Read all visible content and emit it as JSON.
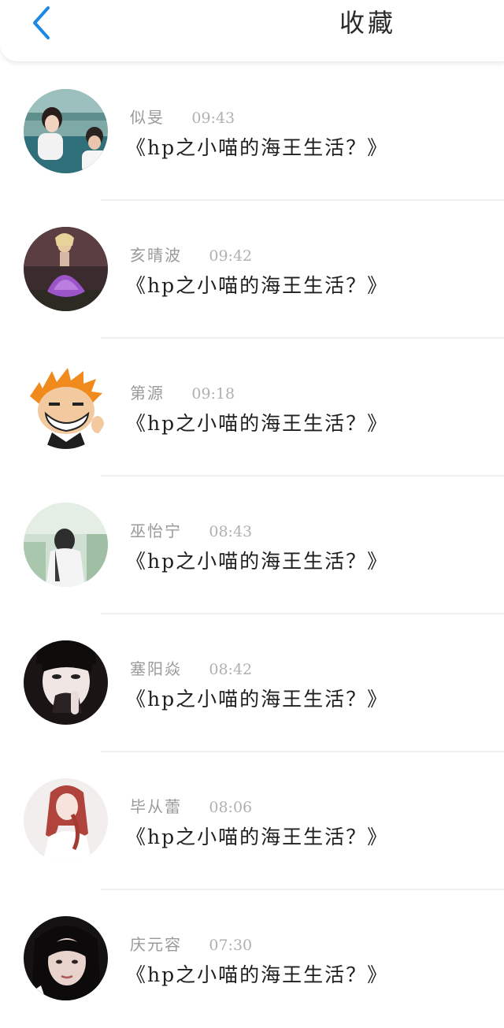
{
  "header": {
    "back_icon": "chevron-left-icon",
    "title": "收藏",
    "accent_color": "#1e88e5"
  },
  "items": [
    {
      "name": "似旻",
      "time": "09:43",
      "message": "《hp之小喵的海王生活？》",
      "avatar": "couple-train-photo"
    },
    {
      "name": "亥晴波",
      "time": "09:42",
      "message": "《hp之小喵的海王生活？》",
      "avatar": "purple-dress-girl-photo"
    },
    {
      "name": "第源",
      "time": "09:18",
      "message": "《hp之小喵的海王生活？》",
      "avatar": "anime-orange-hair-boy"
    },
    {
      "name": "巫怡宁",
      "time": "08:43",
      "message": "《hp之小喵的海王生活？》",
      "avatar": "girl-in-garden-photo"
    },
    {
      "name": "塞阳焱",
      "time": "08:42",
      "message": "《hp之小喵的海王生活？》",
      "avatar": "dark-hair-boy-photo"
    },
    {
      "name": "毕从蕾",
      "time": "08:06",
      "message": "《hp之小喵的海王生活？》",
      "avatar": "red-hair-girl-photo"
    },
    {
      "name": "庆元容",
      "time": "07:30",
      "message": "《hp之小喵的海王生活？》",
      "avatar": "black-hair-girl-photo"
    }
  ]
}
